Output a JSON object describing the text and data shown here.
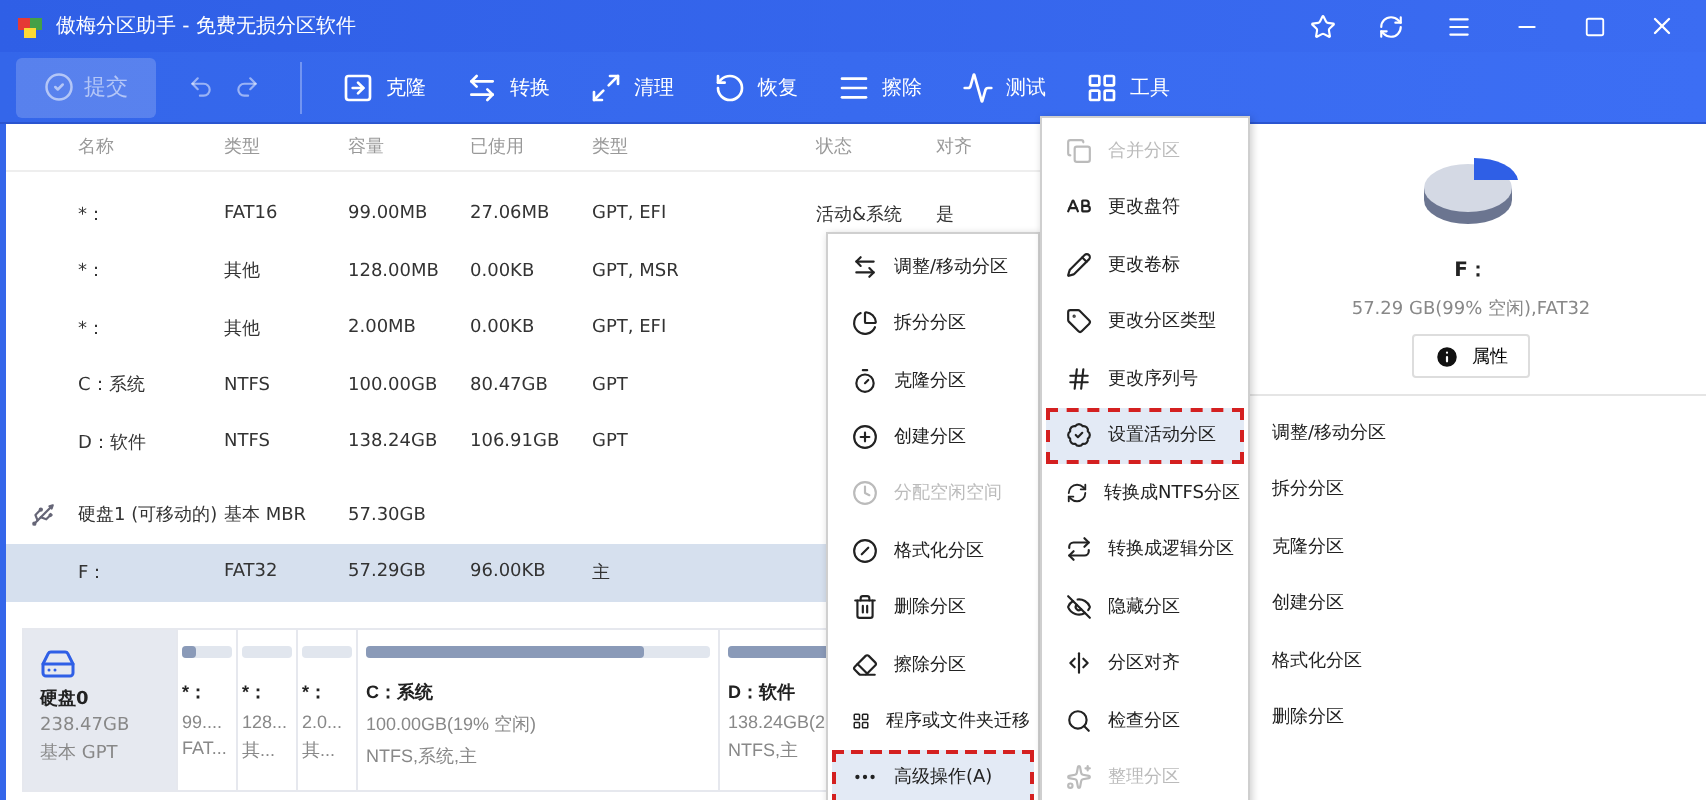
{
  "window": {
    "title": "傲梅分区助手 - 免费无损分区软件"
  },
  "toolbar": {
    "commit": {
      "label": "提交",
      "disabled": true
    },
    "tools": [
      {
        "label": "克隆"
      },
      {
        "label": "转换"
      },
      {
        "label": "清理"
      },
      {
        "label": "恢复"
      },
      {
        "label": "擦除"
      },
      {
        "label": "测试"
      },
      {
        "label": "工具"
      }
    ]
  },
  "table": {
    "columns": [
      "名称",
      "类型",
      "容量",
      "已使用",
      "类型",
      "状态",
      "对齐"
    ],
    "rows": [
      {
        "kind": "partition",
        "selected": false,
        "cells": [
          "*：",
          "FAT16",
          "99.00MB",
          "27.06MB",
          "GPT, EFI",
          "活动&系统",
          "是"
        ]
      },
      {
        "kind": "partition",
        "selected": false,
        "cells": [
          "*：",
          "其他",
          "128.00MB",
          "0.00KB",
          "GPT, MSR"
        ]
      },
      {
        "kind": "partition",
        "selected": false,
        "cells": [
          "*：",
          "其他",
          "2.00MB",
          "0.00KB",
          "GPT, EFI"
        ]
      },
      {
        "kind": "partition",
        "selected": false,
        "cells": [
          "C：系统",
          "NTFS",
          "100.00GB",
          "80.47GB",
          "GPT"
        ]
      },
      {
        "kind": "partition",
        "selected": false,
        "cells": [
          "D：软件",
          "NTFS",
          "138.24GB",
          "106.91GB",
          "GPT"
        ]
      },
      {
        "kind": "disk",
        "selected": false,
        "cells": [
          "硬盘1 (可移动的)",
          "基本 MBR",
          "57.30GB"
        ]
      },
      {
        "kind": "partition",
        "selected": true,
        "cells": [
          "F：",
          "FAT32",
          "57.29GB",
          "96.00KB",
          "主"
        ]
      }
    ]
  },
  "disk_map": {
    "disk": {
      "name": "硬盘0",
      "size": "238.47GB",
      "style": "基本 GPT"
    },
    "partitions": [
      {
        "name": "*：",
        "size": "99....",
        "type": "FAT...",
        "level": 0.27
      },
      {
        "name": "*：",
        "size": "128...",
        "type": "其..."
      },
      {
        "name": "*：",
        "size": "2.0...",
        "type": "其..."
      },
      {
        "name": "C：系统",
        "size": "100.00GB(19% 空闲)",
        "type": "NTFS,系统,主",
        "level": 0.81
      },
      {
        "name": "D：软件",
        "size": "138.24GB(2",
        "type": "NTFS,主",
        "level": 0.77
      }
    ]
  },
  "details": {
    "name": "F：",
    "info": "57.29 GB(99% 空闲),FAT32",
    "button": "属性",
    "operations": [
      "调整/移动分区",
      "拆分分区",
      "克隆分区",
      "创建分区",
      "格式化分区",
      "删除分区"
    ]
  },
  "context_menu": {
    "items": [
      {
        "label": "调整/移动分区",
        "disabled": false,
        "highlighted": false
      },
      {
        "label": "拆分分区",
        "disabled": false,
        "highlighted": false
      },
      {
        "label": "克隆分区",
        "disabled": false,
        "highlighted": false
      },
      {
        "label": "创建分区",
        "disabled": false,
        "highlighted": false
      },
      {
        "label": "分配空闲空间",
        "disabled": true,
        "highlighted": false
      },
      {
        "label": "格式化分区",
        "disabled": false,
        "highlighted": false
      },
      {
        "label": "删除分区",
        "disabled": false,
        "highlighted": false
      },
      {
        "label": "擦除分区",
        "disabled": false,
        "highlighted": false
      },
      {
        "label": "程序或文件夹迁移",
        "disabled": false,
        "highlighted": false
      },
      {
        "label": "高级操作(A)",
        "disabled": false,
        "highlighted": true
      }
    ]
  },
  "submenu": {
    "items": [
      {
        "label": "合并分区",
        "disabled": true,
        "highlighted": false
      },
      {
        "label": "更改盘符",
        "disabled": false,
        "highlighted": false
      },
      {
        "label": "更改卷标",
        "disabled": false,
        "highlighted": false
      },
      {
        "label": "更改分区类型",
        "disabled": false,
        "highlighted": false
      },
      {
        "label": "更改序列号",
        "disabled": false,
        "highlighted": false
      },
      {
        "label": "设置活动分区",
        "disabled": false,
        "highlighted": true
      },
      {
        "label": "转换成NTFS分区",
        "disabled": false,
        "highlighted": false
      },
      {
        "label": "转换成逻辑分区",
        "disabled": false,
        "highlighted": false
      },
      {
        "label": "隐藏分区",
        "disabled": false,
        "highlighted": false
      },
      {
        "label": "分区对齐",
        "disabled": false,
        "highlighted": false
      },
      {
        "label": "检查分区",
        "disabled": false,
        "highlighted": false
      },
      {
        "label": "整理分区",
        "disabled": true,
        "highlighted": false
      }
    ]
  }
}
